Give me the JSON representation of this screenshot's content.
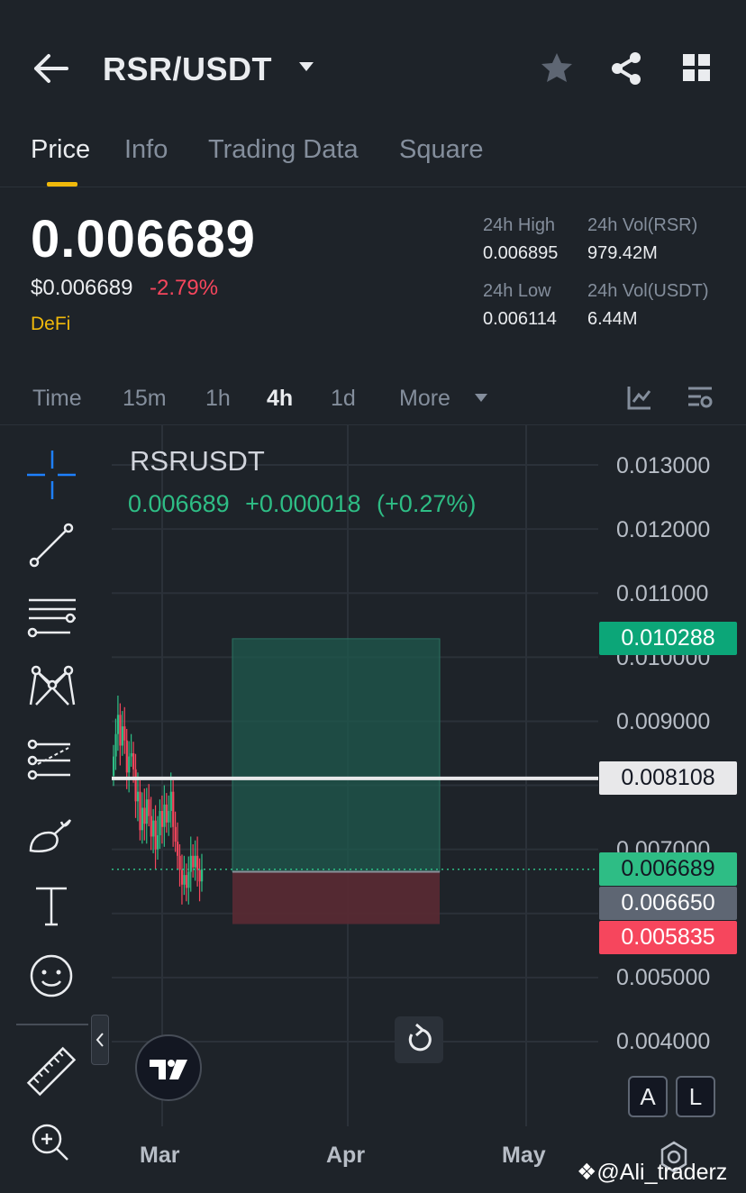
{
  "header": {
    "pair": "RSR/USDT",
    "icons": [
      "back-arrow-icon",
      "chevron-down-icon",
      "star-icon",
      "share-icon",
      "grid-icon"
    ]
  },
  "tabs": [
    {
      "label": "Price",
      "active": true
    },
    {
      "label": "Info",
      "active": false
    },
    {
      "label": "Trading Data",
      "active": false
    },
    {
      "label": "Square",
      "active": false
    }
  ],
  "price": {
    "last": "0.006689",
    "usd": "$0.006689",
    "change": "-2.79%",
    "tag": "DeFi",
    "change_color": "#f6465d",
    "tag_color": "#f0b90b"
  },
  "stats": {
    "high_label": "24h High",
    "high_value": "0.006895",
    "vol_base_label": "24h Vol(RSR)",
    "vol_base_value": "979.42M",
    "low_label": "24h Low",
    "low_value": "0.006114",
    "vol_quote_label": "24h Vol(USDT)",
    "vol_quote_value": "6.44M"
  },
  "intervals": [
    {
      "label": "Time",
      "active": false
    },
    {
      "label": "15m",
      "active": false
    },
    {
      "label": "1h",
      "active": false
    },
    {
      "label": "4h",
      "active": true
    },
    {
      "label": "1d",
      "active": false
    },
    {
      "label": "More",
      "active": false
    }
  ],
  "chart": {
    "symbol": "RSRUSDT",
    "last": "0.006689",
    "change_abs": "+0.000018",
    "change_pct": "(+0.27%)",
    "y_ticks": [
      "0.013000",
      "0.012000",
      "0.011000",
      "0.010000",
      "0.009000",
      "0.007000",
      "0.005000",
      "0.004000"
    ],
    "x_ticks": [
      "Mar",
      "Apr",
      "May"
    ],
    "price_tags": {
      "target": "0.010288",
      "resistance": "0.008108",
      "current": "0.006689",
      "entry": "0.006650",
      "stop": "0.005835"
    },
    "colors": {
      "up": "#2ebd85",
      "down": "#f6465d",
      "target_tag": "#0ca678",
      "entry_tag": "#5e6673",
      "line": "#e8e8ea"
    },
    "al_buttons": [
      "A",
      "L"
    ],
    "watermark": "@Ali_traderz"
  },
  "chart_data": {
    "type": "candlestick",
    "y_range": [
      0.0036,
      0.0137
    ],
    "candles_close": [
      0.00845,
      0.0088,
      0.0091,
      0.00862,
      0.00892,
      0.0087,
      0.0082,
      0.00845,
      0.0085,
      0.00825,
      0.00775,
      0.0079,
      0.0073,
      0.00765,
      0.0074,
      0.00778,
      0.00752,
      0.0072,
      0.00745,
      0.007,
      0.00722,
      0.0076,
      0.00735,
      0.0077,
      0.00742,
      0.0076,
      0.0079,
      0.00735,
      0.00712,
      0.0069,
      0.00668,
      0.00645,
      0.0066,
      0.0064,
      0.00665,
      0.0069,
      0.00672,
      0.0069,
      0.00668,
      0.0065,
      0.00669
    ],
    "horizontal_levels": [
      0.008108
    ],
    "position": {
      "entry": 0.00665,
      "target": 0.010288,
      "stop": 0.005835
    },
    "current_price": 0.006689
  }
}
